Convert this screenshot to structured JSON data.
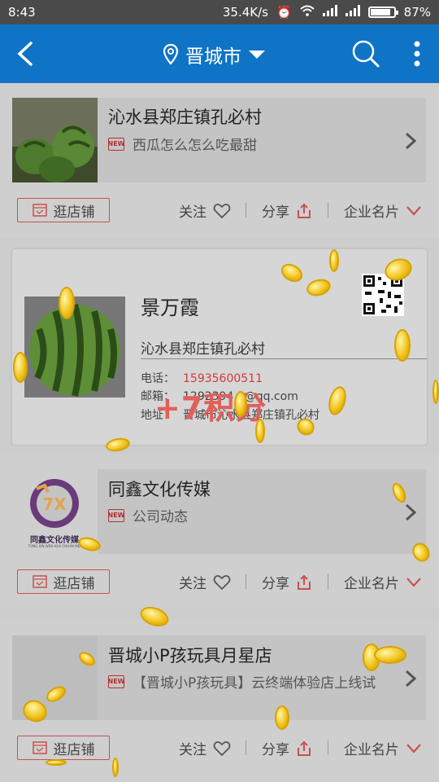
{
  "status_bar": {
    "time": "8:43",
    "net_speed": "35.4K/s",
    "battery_text": "87%",
    "battery_level": 0.87
  },
  "app_bar": {
    "city": "晋城市",
    "back_icon": "arrow-left-icon",
    "location_icon": "map-pin-icon",
    "search_icon": "search-icon",
    "more_icon": "more-vertical-icon"
  },
  "common_actions": {
    "shop": "逛店铺",
    "follow": "关注",
    "share": "分享",
    "card": "企业名片"
  },
  "listings": [
    {
      "title": "沁水县郑庄镇孔必村",
      "subtitle": "西瓜怎么怎么吃最甜"
    },
    {
      "title": "同鑫文化传媒",
      "subtitle": "公司动态",
      "logo_text": "同鑫文化传媒",
      "logo_sub": "TONG XIN WEN HUA CHUAN MEI"
    },
    {
      "title": "晋城小P孩玩具月星店",
      "subtitle": "【晋城小P孩玩具】云终端体验店上线试"
    }
  ],
  "business_card": {
    "name": "景万霞",
    "company": "沁水县郑庄镇孔必村",
    "phone_label": "电话：",
    "phone": "15935600511",
    "email_label": "邮箱：",
    "email": "1292394...@qq.com",
    "address_label": "地址：",
    "address": "晋城市沁水县郑庄镇孔必村"
  },
  "reward_text": "+7积分",
  "colors": {
    "app_bar": "#0f73c6",
    "status_bar": "#4a4a4a",
    "accent_red": "#c95050",
    "coin": "#f2c41d"
  }
}
